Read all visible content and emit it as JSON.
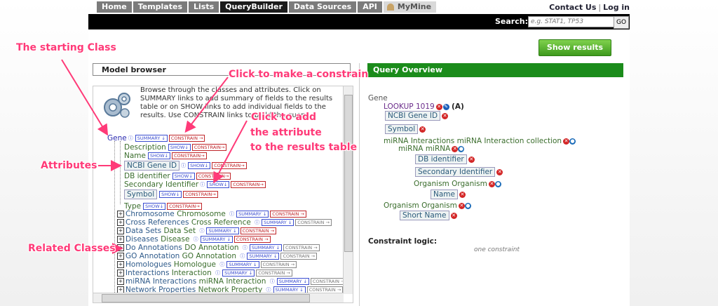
{
  "nav": {
    "tabs": [
      "Home",
      "Templates",
      "Lists",
      "QueryBuilder",
      "Data Sources",
      "API",
      "MyMine"
    ],
    "active_tab": "QueryBuilder",
    "contact": "Contact Us",
    "login": "Log in"
  },
  "search": {
    "label": "Search:",
    "placeholder": "e.g. STAT1, TP53",
    "go": "GO"
  },
  "show_results": "Show results",
  "model_browser": {
    "title": "Model browser",
    "intro": "Browse through the classes and attributes. Click on SUMMARY links to add summary of fields to the results table or on SHOW links to add individual fields to the results. Use CONSTRAIN links to build the query.",
    "root": "Gene",
    "attributes": [
      "Description",
      "Name",
      "NCBI Gene ID",
      "DB identifier",
      "Secondary Identifier",
      "Symbol",
      "Type"
    ],
    "collections": [
      {
        "name": "Chromosome",
        "type": "Chromosome"
      },
      {
        "name": "Cross References",
        "type": "Cross Reference"
      },
      {
        "name": "Data Sets",
        "type": "Data Set"
      },
      {
        "name": "Diseases",
        "type": "Disease"
      },
      {
        "name": "Do Annotations",
        "type": "DO Annotation"
      },
      {
        "name": "GO Annotation",
        "type": "GO Annotation"
      },
      {
        "name": "Homologues",
        "type": "Homologue"
      },
      {
        "name": "Interactions",
        "type": "Interaction"
      },
      {
        "name": "miRNA Interactions",
        "type": "miRNA Interaction"
      },
      {
        "name": "Network Properties",
        "type": "Network Property"
      }
    ],
    "summary_label": "SUMMARY",
    "constrain_label": "CONSTRAIN",
    "show_label": "SHOW"
  },
  "query_overview": {
    "title": "Query Overview",
    "root": "Gene",
    "lookup": "LOOKUP 1019",
    "lookup_code": "(A)",
    "ncbi": "NCBI Gene ID",
    "symbol": "Symbol",
    "mirna": "miRNA Interactions miRNA Interaction  collection",
    "mirna2": "miRNA miRNA",
    "db": "DB identifier",
    "sec": "Secondary Identifier",
    "org1": "Organism Organism",
    "name": "Name",
    "org2": "Organism Organism",
    "short": "Short Name",
    "constraint_title": "Constraint logic:",
    "constraint_value": "one constraint"
  },
  "annotations": {
    "starting_class": "The starting Class",
    "attributes": "Attributes",
    "related_classes": "Related Classes",
    "make_constraint": "Click to make a constrain",
    "add_attr1": "Click to add",
    "add_attr2": "the attribute",
    "add_attr3": "to the results table"
  },
  "colors": {
    "annotation": "#ff3a78",
    "header_green": "#1b8c1b",
    "button_green": "#4caf2a"
  }
}
